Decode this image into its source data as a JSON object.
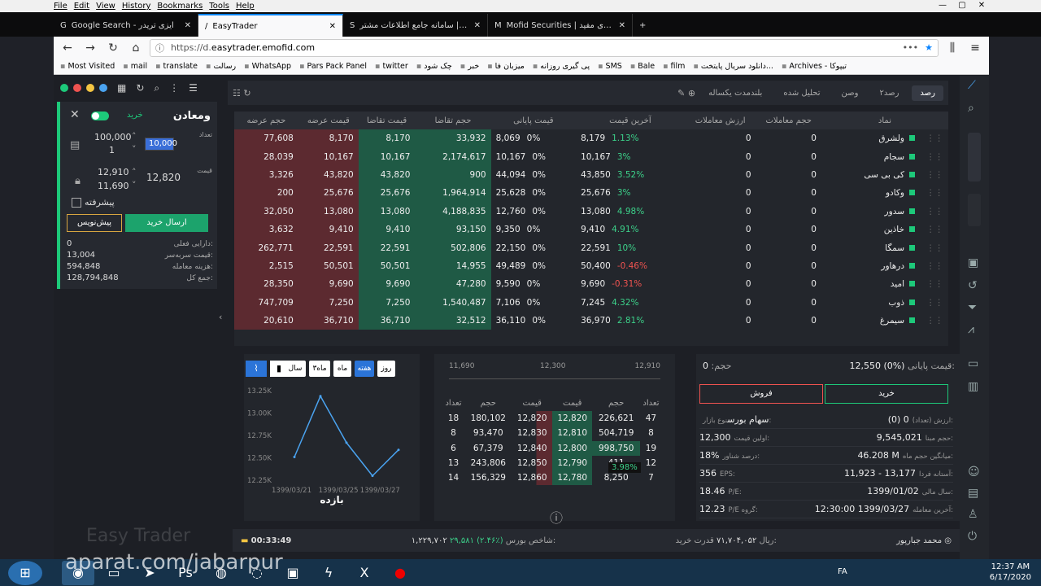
{
  "menubar": {
    "items": [
      "File",
      "Edit",
      "View",
      "History",
      "Bookmarks",
      "Tools",
      "Help"
    ]
  },
  "tabs": [
    {
      "title": "Google Search - ایزی تریدر",
      "icon": "G"
    },
    {
      "title": "EasyTrader",
      "icon": "/"
    },
    {
      "title": "سجام | سامانه جامع اطلاعات مشتر",
      "icon": "S"
    },
    {
      "title": "Mofid Securities | کارگزاری مفید",
      "icon": "M"
    }
  ],
  "url": {
    "prefix": "https://d.",
    "domain": "easytrader.emofid.com"
  },
  "bookmarks": [
    "Most Visited",
    "mail",
    "translate",
    "رسالت",
    "WhatsApp",
    "Pars Pack Panel",
    "twitter",
    "چک شود",
    "خبر",
    "میزبان فا",
    "پی گیری روزانه",
    "SMS",
    "Bale",
    "film",
    "دانلود سریال پایتخت...",
    "Archives - تیپوکا"
  ],
  "order": {
    "title": "ومعادن",
    "side_label": "خرید",
    "qty_label": "تعداد",
    "qty_max": "100,000",
    "qty_min": "1",
    "qty_value": "10,000",
    "price_label": "قیمت",
    "price_max": "12,910",
    "price_min": "11,690",
    "price_value": "12,820",
    "draft_check": "پیشرفته",
    "submit": "ارسال خرید",
    "draft": "پیش‌نویس",
    "stats": [
      {
        "v": "0",
        "k": "دارایی فعلی:"
      },
      {
        "v": "13,004",
        "k": "قیمت سربه‌سر:"
      },
      {
        "v": "594,848",
        "k": "هزینه معامله:"
      },
      {
        "v": "128,794,848",
        "k": "جمع کل:"
      }
    ]
  },
  "toptabs": [
    "رصد",
    "رصد۲",
    "وصن",
    "تحلیل شده",
    "بلندمدت یکساله"
  ],
  "watch_headers": [
    "حجم عرضه",
    "قیمت عرضه",
    "قیمت تقاضا",
    "حجم تقاضا",
    "قیمت پایانی",
    "آخرین قیمت",
    "ارزش معاملات",
    "حجم معاملات",
    "نماد"
  ],
  "watch_rows": [
    [
      "77,608",
      "8,170",
      "8,170",
      "33,932",
      "8,069",
      "0%",
      "8,179",
      "1.13%",
      "0",
      "0",
      "ولشرق"
    ],
    [
      "28,039",
      "10,167",
      "10,167",
      "2,174,617",
      "10,167",
      "0%",
      "10,167",
      "3%",
      "0",
      "0",
      "سجام"
    ],
    [
      "3,326",
      "43,820",
      "43,820",
      "900",
      "44,094",
      "0%",
      "43,850",
      "3.52%",
      "0",
      "0",
      "کی بی سی"
    ],
    [
      "200",
      "25,676",
      "25,676",
      "1,964,914",
      "25,628",
      "0%",
      "25,676",
      "3%",
      "0",
      "0",
      "وکادو"
    ],
    [
      "32,050",
      "13,080",
      "13,080",
      "4,188,835",
      "12,760",
      "0%",
      "13,080",
      "4.98%",
      "0",
      "0",
      "سدور"
    ],
    [
      "3,632",
      "9,410",
      "9,410",
      "93,150",
      "9,350",
      "0%",
      "9,410",
      "4.91%",
      "0",
      "0",
      "خاذین"
    ],
    [
      "262,771",
      "22,591",
      "22,591",
      "502,806",
      "22,150",
      "0%",
      "22,591",
      "10%",
      "0",
      "0",
      "سمگا"
    ],
    [
      "2,515",
      "50,501",
      "50,501",
      "14,955",
      "49,489",
      "0%",
      "50,400",
      "-0.46%",
      "0",
      "0",
      "درهاور"
    ],
    [
      "28,350",
      "9,690",
      "9,690",
      "47,280",
      "9,590",
      "0%",
      "9,690",
      "-0.31%",
      "0",
      "0",
      "امید"
    ],
    [
      "747,709",
      "7,250",
      "7,250",
      "1,540,487",
      "7,106",
      "0%",
      "7,245",
      "4.32%",
      "0",
      "0",
      "ذوب"
    ],
    [
      "20,610",
      "36,710",
      "36,710",
      "32,512",
      "36,110",
      "0%",
      "36,970",
      "2.81%",
      "0",
      "0",
      "سیمرغ"
    ]
  ],
  "chart": {
    "buttons": [
      "روز",
      "هفته",
      "ماه",
      "۳ماه",
      "سال"
    ],
    "title": "بازده",
    "ylabels": [
      "13.25K",
      "13.00K",
      "12.75K",
      "12.50K",
      "12.25K"
    ],
    "xlabels": [
      "1399/03/21",
      "1399/03/25",
      "1399/03/27"
    ]
  },
  "chart_data": {
    "type": "line",
    "title": "بازده",
    "x": [
      "1399/03/21",
      "1399/03/23",
      "1399/03/25",
      "1399/03/26",
      "1399/03/27"
    ],
    "values": [
      12500,
      13180,
      12660,
      12290,
      12580
    ],
    "ylim": [
      12250,
      13250
    ]
  },
  "depth": {
    "range": [
      "11,690",
      "12,300",
      "12,910"
    ],
    "headers": [
      "تعداد",
      "حجم",
      "قیمت",
      "قیمت",
      "حجم",
      "تعداد"
    ],
    "rows": [
      [
        "18",
        "180,102",
        "12,820",
        "12,820",
        "226,621",
        "47"
      ],
      [
        "8",
        "93,470",
        "12,830",
        "12,810",
        "504,719",
        "8"
      ],
      [
        "6",
        "67,379",
        "12,840",
        "12,800",
        "998,750",
        "19"
      ],
      [
        "13",
        "243,806",
        "12,850",
        "12,790",
        "411",
        "12"
      ],
      [
        "14",
        "156,329",
        "12,860",
        "12,780",
        "8,250",
        "7"
      ]
    ],
    "tooltip": "3.98%"
  },
  "info": {
    "last_label": "قیمت پایانی:",
    "last": "12,550 (0%)",
    "vol_label": "حجم:",
    "vol": "0",
    "buy": "خرید",
    "sell": "فروش",
    "rows": [
      [
        "(0) 0",
        "ارزش (تعداد):",
        "سهام بورس",
        "نوع بازار:"
      ],
      [
        "9,545,021",
        "حجم مبنا:",
        "12,300",
        "اولین قیمت:"
      ],
      [
        "46.208 M",
        "میانگین حجم ماه:",
        "18%",
        "درصد شناور:"
      ],
      [
        "11,923 - 13,177",
        "آستانه فردا:",
        "356",
        "EPS:"
      ],
      [
        "1399/01/02",
        "سال مالی:",
        "18.46",
        "P/E:"
      ],
      [
        "12:30:00 1399/03/27",
        "آخرین معامله:",
        "12.23",
        "P/E گروه:"
      ]
    ]
  },
  "status": {
    "user": "محمد جبارپور",
    "power_label": "قدرت خرید:",
    "power": "۷۱,۷۰۴,۰۵۲",
    "rial": "ریال",
    "index_label": "شاخص بورس:",
    "index": "۱,۲۲۹,۷۰۲",
    "index_change": "۲۹,۵۸۱ (۲.۴۶٪)",
    "timer": "00:33:49"
  },
  "taskbar": {
    "lang": "FA",
    "time": "12:37 AM",
    "date": "6/17/2020"
  },
  "watermark": "aparat.com/jabarpur",
  "brand": "Easy Trader"
}
